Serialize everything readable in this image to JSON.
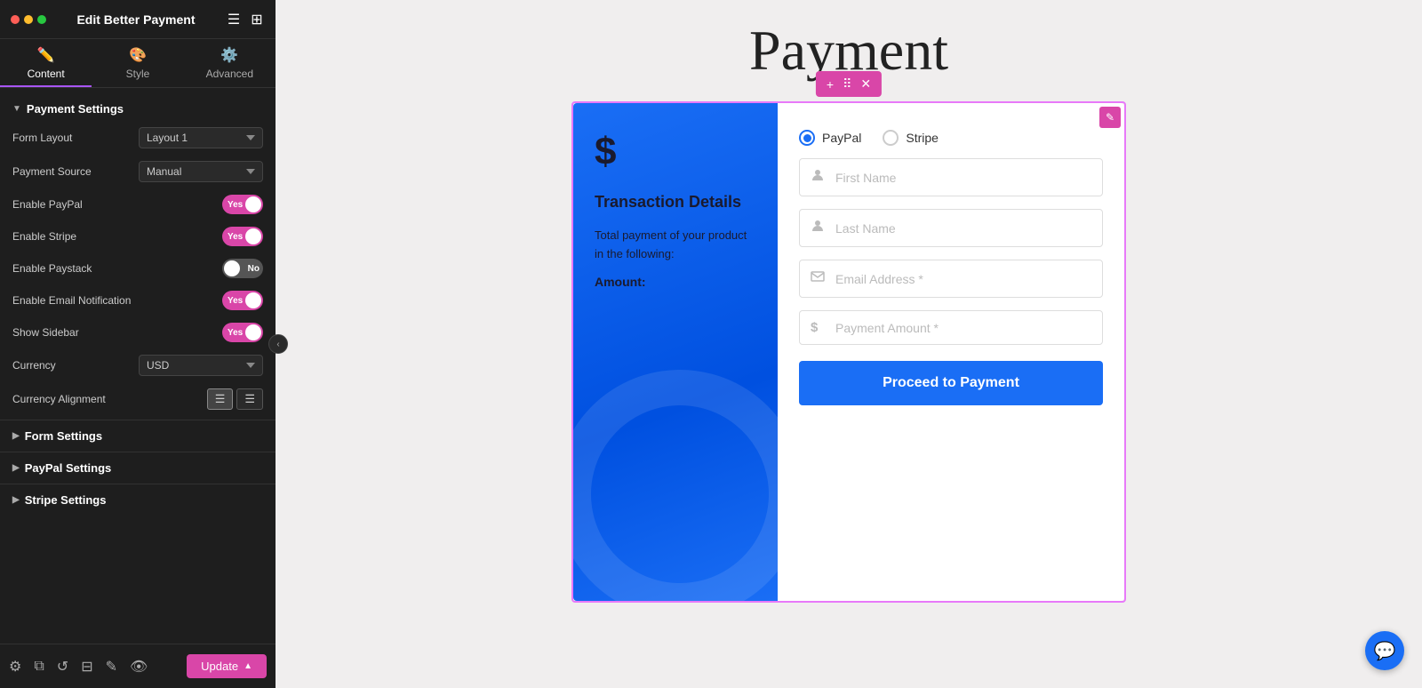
{
  "app": {
    "title": "Edit Better Payment",
    "traffic_lights": [
      "red",
      "yellow",
      "green"
    ]
  },
  "tabs": [
    {
      "id": "content",
      "label": "Content",
      "icon": "✏️",
      "active": true
    },
    {
      "id": "style",
      "label": "Style",
      "icon": "🎨",
      "active": false
    },
    {
      "id": "advanced",
      "label": "Advanced",
      "icon": "⚙️",
      "active": false
    }
  ],
  "sidebar": {
    "payment_settings": {
      "title": "Payment Settings",
      "form_layout": {
        "label": "Form Layout",
        "value": "Layout 1"
      },
      "payment_source": {
        "label": "Payment Source",
        "value": "Manual"
      },
      "enable_paypal": {
        "label": "Enable PayPal",
        "value": true,
        "toggle_label": "Yes"
      },
      "enable_stripe": {
        "label": "Enable Stripe",
        "value": true,
        "toggle_label": "Yes"
      },
      "enable_paystack": {
        "label": "Enable Paystack",
        "value": false,
        "toggle_label": "No"
      },
      "enable_email_notification": {
        "label": "Enable Email Notification",
        "value": true,
        "toggle_label": "Yes"
      },
      "show_sidebar": {
        "label": "Show Sidebar",
        "value": true,
        "toggle_label": "Yes"
      },
      "currency": {
        "label": "Currency",
        "value": "USD"
      },
      "currency_alignment": {
        "label": "Currency Alignment"
      }
    },
    "form_settings": {
      "title": "Form Settings"
    },
    "paypal_settings": {
      "title": "PayPal Settings"
    },
    "stripe_settings": {
      "title": "Stripe Settings"
    }
  },
  "footer": {
    "update_button": "Update"
  },
  "main": {
    "page_title": "Payment",
    "widget": {
      "toolbar": {
        "add_icon": "+",
        "move_icon": "⠿",
        "close_icon": "✕"
      },
      "left_panel": {
        "dollar_sign": "$",
        "transaction_title": "Transaction Details",
        "description": "Total payment of your product in the following:",
        "amount_label": "Amount:"
      },
      "right_panel": {
        "payment_methods": [
          {
            "id": "paypal",
            "label": "PayPal",
            "selected": true
          },
          {
            "id": "stripe",
            "label": "Stripe",
            "selected": false
          }
        ],
        "fields": [
          {
            "id": "first_name",
            "placeholder": "First Name",
            "icon": "👤"
          },
          {
            "id": "last_name",
            "placeholder": "Last Name",
            "icon": "👤"
          },
          {
            "id": "email",
            "placeholder": "Email Address *",
            "icon": "✉️"
          },
          {
            "id": "payment_amount",
            "placeholder": "Payment Amount *",
            "icon": "$"
          }
        ],
        "submit_button": "Proceed to Payment"
      }
    }
  }
}
